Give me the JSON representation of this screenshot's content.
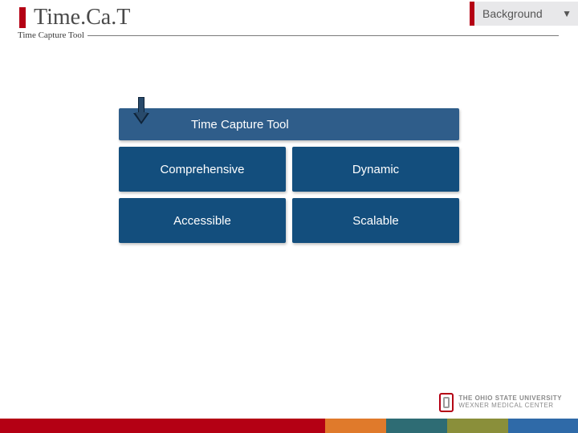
{
  "header": {
    "title": "Time.Ca.T",
    "subtitle": "Time Capture Tool"
  },
  "badge": {
    "label": "Background"
  },
  "smartart": {
    "title": "Time Capture Tool",
    "cells": {
      "c1": "Comprehensive",
      "c2": "Dynamic",
      "c3": "Accessible",
      "c4": "Scalable"
    }
  },
  "logo": {
    "line1": "THE OHIO STATE UNIVERSITY",
    "line2": "WEXNER MEDICAL CENTER"
  }
}
